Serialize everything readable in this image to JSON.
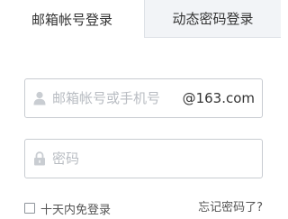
{
  "tabs": [
    {
      "label": "邮箱帐号登录",
      "active": true
    },
    {
      "label": "动态密码登录",
      "active": false
    }
  ],
  "account": {
    "placeholder": "邮箱帐号或手机号",
    "value": "",
    "suffix": "@163.com",
    "icon": "user-icon"
  },
  "password": {
    "placeholder": "密码",
    "value": "",
    "icon": "lock-icon"
  },
  "remember": {
    "label": "十天内免登录",
    "checked": false
  },
  "forgot": {
    "label": "忘记密码了?"
  }
}
